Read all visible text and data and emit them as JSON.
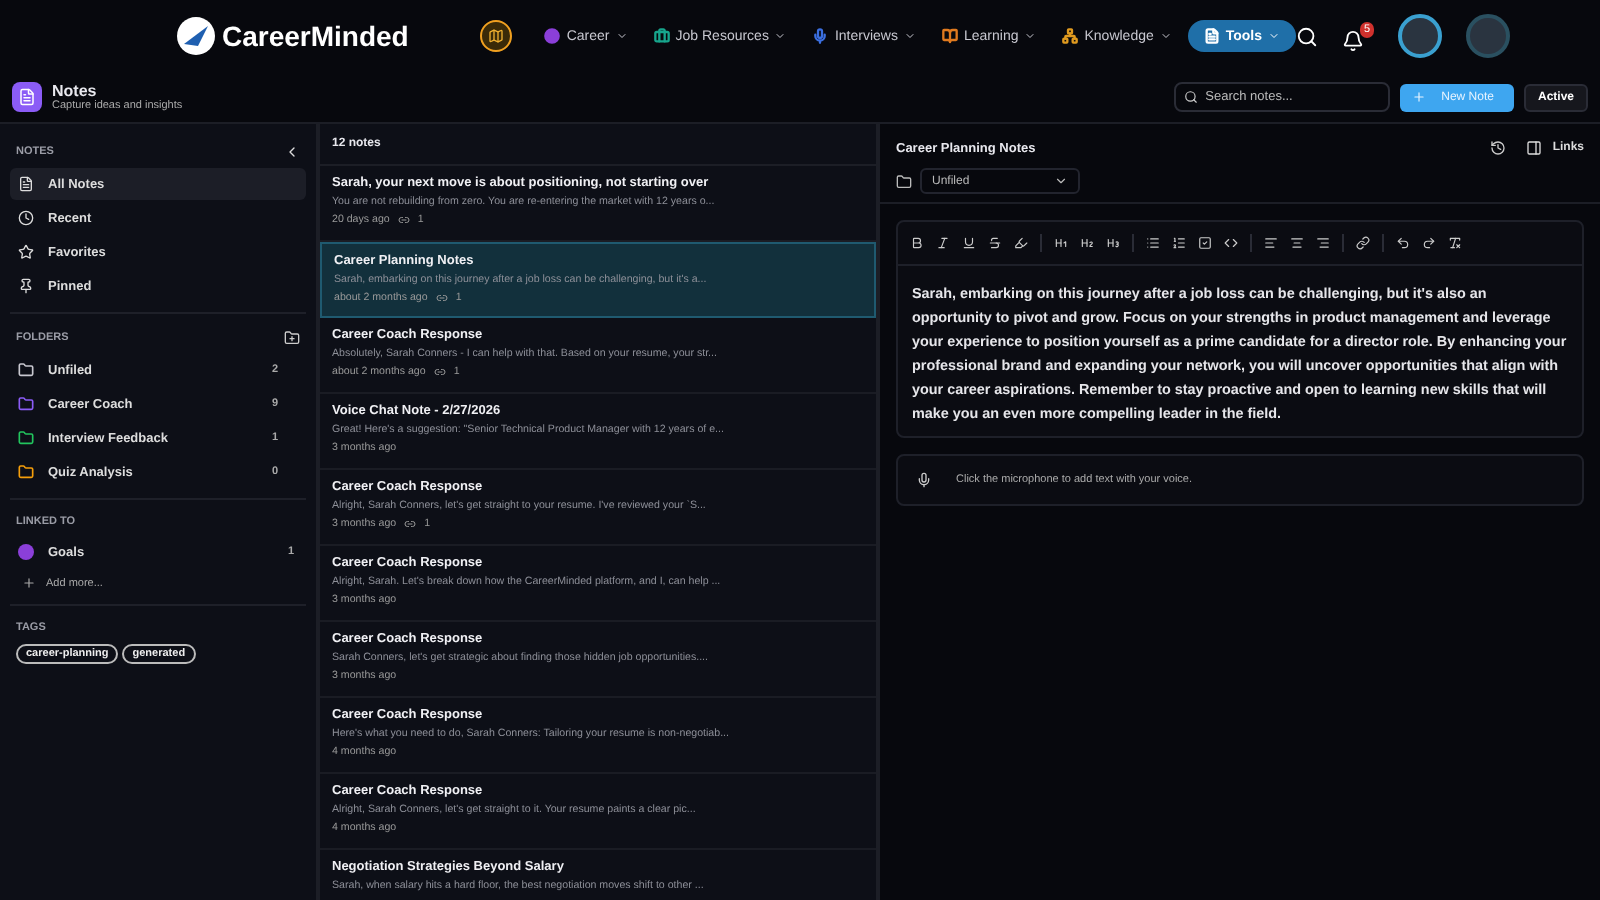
{
  "brand": "CareerMinded",
  "nav": [
    {
      "label": "Career",
      "color": "#8b3fd9",
      "selected": false
    },
    {
      "label": "Job Resources",
      "color": "#17a58c",
      "selected": false
    },
    {
      "label": "Interviews",
      "color": "#3b6fe0",
      "selected": false
    },
    {
      "label": "Learning",
      "color": "#e07a1f",
      "selected": false
    },
    {
      "label": "Knowledge",
      "color": "#e09a1f",
      "selected": false
    },
    {
      "label": "Tools",
      "color": "#ffffff",
      "selected": true
    }
  ],
  "notifications": "5",
  "page": {
    "title": "Notes",
    "subtitle": "Capture ideas and insights"
  },
  "search": {
    "placeholder": "Search notes..."
  },
  "new_note": "New Note",
  "active_button": "Active",
  "sidebar": {
    "heading": "NOTES",
    "items": [
      {
        "label": "All Notes",
        "selected": true
      },
      {
        "label": "Recent",
        "selected": false
      },
      {
        "label": "Favorites",
        "selected": false
      },
      {
        "label": "Pinned",
        "selected": false
      }
    ],
    "folders_heading": "FOLDERS",
    "folders": [
      {
        "label": "Unfiled",
        "count": "2",
        "color": "#c8c8d0"
      },
      {
        "label": "Career Coach",
        "count": "9",
        "color": "#8b5cf6"
      },
      {
        "label": "Interview Feedback",
        "count": "1",
        "color": "#22c55e"
      },
      {
        "label": "Quiz Analysis",
        "count": "0",
        "color": "#f59e0b"
      }
    ],
    "linked_heading": "LINKED TO",
    "linked": [
      {
        "label": "Goals",
        "count": "1",
        "color": "#8b3fd9"
      }
    ],
    "add_more": "Add more...",
    "tags_heading": "TAGS",
    "tags": [
      "career-planning",
      "generated"
    ]
  },
  "list": {
    "count": "12 notes",
    "notes": [
      {
        "title": "Sarah, your next move is about positioning, not starting over",
        "preview": "You are not rebuilding from zero. You are re-entering the market with 12 years o...",
        "time": "20 days ago",
        "links": "1",
        "selected": false
      },
      {
        "title": "Career Planning Notes",
        "preview": "Sarah, embarking on this journey after a job loss can be challenging, but it's a...",
        "time": "about 2 months ago",
        "links": "1",
        "selected": true
      },
      {
        "title": "Career Coach Response",
        "preview": "Absolutely, Sarah Conners - I can help with that. Based on your resume, your str...",
        "time": "about 2 months ago",
        "links": "1",
        "selected": false
      },
      {
        "title": "Voice Chat Note - 2/27/2026",
        "preview": "Great! Here's a suggestion: \"Senior Technical Product Manager with 12 years of e...",
        "time": "3 months ago",
        "selected": false
      },
      {
        "title": "Career Coach Response",
        "preview": "Alright, Sarah Conners, let's get straight to your resume. I've reviewed your `S...",
        "time": "3 months ago",
        "links": "1",
        "selected": false
      },
      {
        "title": "Career Coach Response",
        "preview": "Alright, Sarah. Let's break down how the CareerMinded platform, and I, can help ...",
        "time": "3 months ago",
        "selected": false
      },
      {
        "title": "Career Coach Response",
        "preview": "Sarah Conners, let's get strategic about finding those hidden job opportunities....",
        "time": "3 months ago",
        "selected": false
      },
      {
        "title": "Career Coach Response",
        "preview": "Here's what you need to do, Sarah Conners: Tailoring your resume is non-negotiab...",
        "time": "4 months ago",
        "selected": false
      },
      {
        "title": "Career Coach Response",
        "preview": "Alright, Sarah Conners, let's get straight to it. Your resume paints a clear pic...",
        "time": "4 months ago",
        "selected": false
      },
      {
        "title": "Negotiation Strategies Beyond Salary",
        "preview": "Sarah, when salary hits a hard floor, the best negotiation moves shift to other ...",
        "selected": false
      }
    ]
  },
  "editor": {
    "title": "Career Planning Notes",
    "links_button": "Links",
    "folder": "Unfiled",
    "body": "Sarah, embarking on this journey after a job loss can be challenging, but it's also an opportunity to pivot and grow. Focus on your strengths in product management and leverage your experience to position yourself as a prime candidate for a director role. By enhancing your professional brand and expanding your network, you will uncover opportunities that align with your career aspirations. Remember to stay proactive and open to learning new skills that will make you an even more compelling leader in the field.",
    "voice_hint": "Click the microphone to add text with your voice."
  }
}
